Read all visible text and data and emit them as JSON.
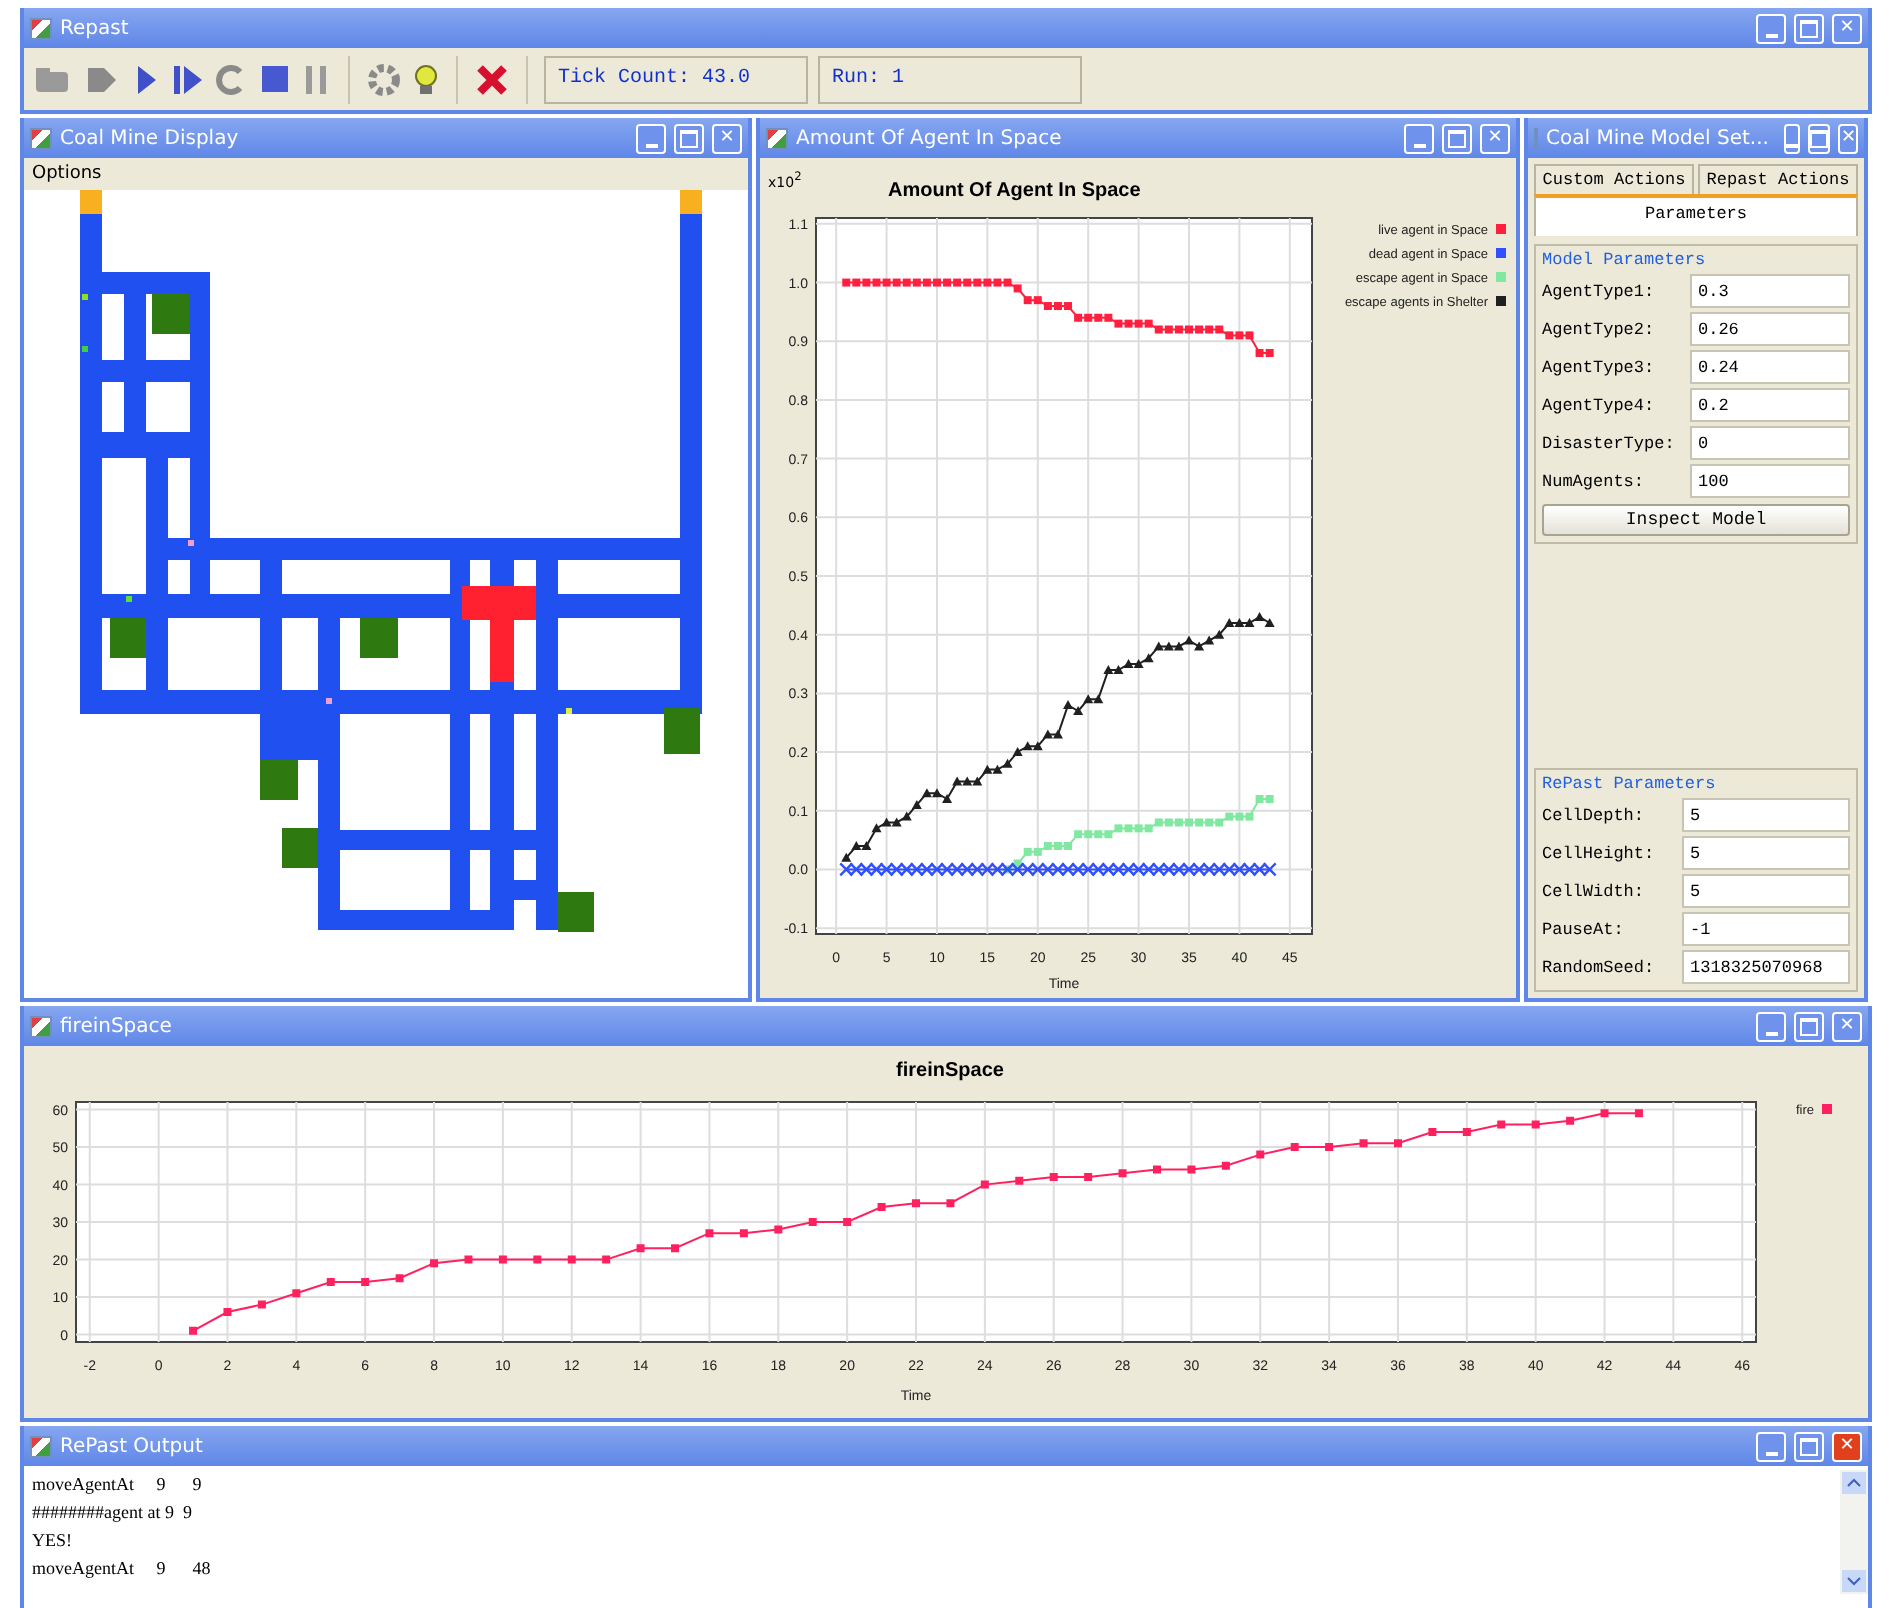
{
  "main_window": {
    "title": "Repast",
    "close_glyph": "✕",
    "tick_count": "Tick Count: 43.0",
    "run": "Run: 1"
  },
  "display_window": {
    "title": "Coal Mine Display",
    "close_glyph": "✕",
    "menu": [
      "Options"
    ]
  },
  "agents_chart_window": {
    "title": "Amount Of Agent In Space",
    "close_glyph": "✕",
    "scale_label": "x10$^{2}$",
    "chart_data": {
      "type": "line",
      "title": "Amount Of Agent In Space",
      "xlabel": "Time",
      "x": [
        1,
        2,
        3,
        4,
        5,
        6,
        7,
        8,
        9,
        10,
        11,
        12,
        13,
        14,
        15,
        16,
        17,
        18,
        19,
        20,
        21,
        22,
        23,
        24,
        25,
        26,
        27,
        28,
        29,
        30,
        31,
        32,
        33,
        34,
        35,
        36,
        37,
        38,
        39,
        40,
        41,
        42,
        43
      ],
      "series": [
        {
          "name": "live agent in Space",
          "color": "#ff2040",
          "marker": "square",
          "values": [
            1,
            1,
            1,
            1,
            1,
            1,
            1,
            1,
            1,
            1,
            1,
            1,
            1,
            1,
            1,
            1,
            1,
            0.99,
            0.97,
            0.97,
            0.96,
            0.96,
            0.96,
            0.94,
            0.94,
            0.94,
            0.94,
            0.93,
            0.93,
            0.93,
            0.93,
            0.92,
            0.92,
            0.92,
            0.92,
            0.92,
            0.92,
            0.92,
            0.91,
            0.91,
            0.91,
            0.88,
            0.88
          ]
        },
        {
          "name": "dead agent in Space",
          "color": "#3050ff",
          "marker": "cross",
          "values": [
            0,
            0,
            0,
            0,
            0,
            0,
            0,
            0,
            0,
            0,
            0,
            0,
            0,
            0,
            0,
            0,
            0,
            0,
            0,
            0,
            0,
            0,
            0,
            0,
            0,
            0,
            0,
            0,
            0,
            0,
            0,
            0,
            0,
            0,
            0,
            0,
            0,
            0,
            0,
            0,
            0,
            0,
            0
          ]
        },
        {
          "name": "escape agent in Space",
          "color": "#80e8a0",
          "marker": "square",
          "values": [
            null,
            null,
            null,
            null,
            null,
            null,
            null,
            null,
            null,
            null,
            null,
            null,
            null,
            null,
            null,
            null,
            0,
            0.01,
            0.03,
            0.03,
            0.04,
            0.04,
            0.04,
            0.06,
            0.06,
            0.06,
            0.06,
            0.07,
            0.07,
            0.07,
            0.07,
            0.08,
            0.08,
            0.08,
            0.08,
            0.08,
            0.08,
            0.08,
            0.09,
            0.09,
            0.09,
            0.12,
            0.12
          ]
        },
        {
          "name": "escape agents in Shelter",
          "color": "#202020",
          "marker": "triangle",
          "values": [
            0.02,
            0.04,
            0.04,
            0.07,
            0.08,
            0.08,
            0.09,
            0.11,
            0.13,
            0.13,
            0.12,
            0.15,
            0.15,
            0.15,
            0.17,
            0.17,
            0.18,
            0.2,
            0.21,
            0.21,
            0.23,
            0.23,
            0.28,
            0.27,
            0.29,
            0.29,
            0.34,
            0.34,
            0.35,
            0.35,
            0.36,
            0.38,
            0.38,
            0.38,
            0.39,
            0.38,
            0.39,
            0.4,
            0.42,
            0.42,
            0.42,
            0.43,
            0.42
          ]
        }
      ],
      "xlim": [
        -2,
        47.2
      ],
      "ylim": [
        -0.11,
        1.11
      ],
      "grid": true,
      "legend": true,
      "xticks": [
        0,
        5,
        10,
        15,
        20,
        25,
        30,
        35,
        40,
        45
      ],
      "yticks": [
        -0.1,
        {
          "value": 0,
          "label": "0.0"
        },
        0.1,
        0.2,
        0.3,
        0.4,
        0.5,
        0.6,
        0.7,
        0.8,
        0.9,
        {
          "value": 1,
          "label": "1.0"
        },
        1.1
      ]
    }
  },
  "settings_window": {
    "title": "Coal Mine Model Set...",
    "close_glyph": "✕",
    "tabs": [
      {
        "label": "Custom Actions",
        "selected": false
      },
      {
        "label": "Repast Actions",
        "selected": false
      },
      {
        "label": "Parameters",
        "selected": true
      }
    ],
    "model_parameters": {
      "title": "Model Parameters",
      "fields": [
        {
          "label": "AgentType1:",
          "value": "0.3"
        },
        {
          "label": "AgentType2:",
          "value": "0.26"
        },
        {
          "label": "AgentType3:",
          "value": "0.24"
        },
        {
          "label": "AgentType4:",
          "value": "0.2"
        },
        {
          "label": "DisasterType:",
          "value": "0"
        },
        {
          "label": "NumAgents:",
          "value": "100"
        }
      ],
      "button": "Inspect Model"
    },
    "repast_parameters": {
      "title": "RePast Parameters",
      "fields": [
        {
          "label": "CellDepth:",
          "value": "5"
        },
        {
          "label": "CellHeight:",
          "value": "5"
        },
        {
          "label": "CellWidth:",
          "value": "5"
        },
        {
          "label": "PauseAt:",
          "value": "-1"
        },
        {
          "label": "RandomSeed:",
          "value": "1318325070968"
        }
      ]
    }
  },
  "fire_chart_window": {
    "title": "fireinSpace",
    "close_glyph": "✕",
    "chart_data": {
      "type": "line",
      "title": "fireinSpace",
      "xlabel": "Time",
      "x": [
        1,
        2,
        3,
        4,
        5,
        6,
        7,
        8,
        9,
        10,
        11,
        12,
        13,
        14,
        15,
        16,
        17,
        18,
        19,
        20,
        21,
        22,
        23,
        24,
        25,
        26,
        27,
        28,
        29,
        30,
        31,
        32,
        33,
        34,
        35,
        36,
        37,
        38,
        39,
        40,
        41,
        42,
        43
      ],
      "series": [
        {
          "name": "fire",
          "color": "#ff2060",
          "marker": "square",
          "values": [
            1,
            6,
            8,
            11,
            14,
            14,
            15,
            19,
            20,
            20,
            20,
            20,
            20,
            23,
            23,
            27,
            27,
            28,
            30,
            30,
            34,
            35,
            35,
            40,
            41,
            42,
            42,
            43,
            44,
            44,
            45,
            48,
            50,
            50,
            51,
            51,
            54,
            54,
            56,
            56,
            57,
            59,
            59
          ]
        }
      ],
      "xlim": [
        -2.4,
        46.4
      ],
      "ylim": [
        -2,
        62
      ],
      "grid": true,
      "legend": true,
      "xticks": [
        -2,
        0,
        2,
        4,
        6,
        8,
        10,
        12,
        14,
        16,
        18,
        20,
        22,
        24,
        26,
        28,
        30,
        32,
        34,
        36,
        38,
        40,
        42,
        44,
        46
      ],
      "yticks": [
        0,
        10,
        20,
        30,
        40,
        50,
        60
      ]
    }
  },
  "output_window": {
    "title": "RePast Output",
    "close_glyph": "✕",
    "lines": [
      "moveAgentAt     9      9",
      "########agent at 9  9",
      "YES!",
      "moveAgentAt     9      48"
    ]
  }
}
